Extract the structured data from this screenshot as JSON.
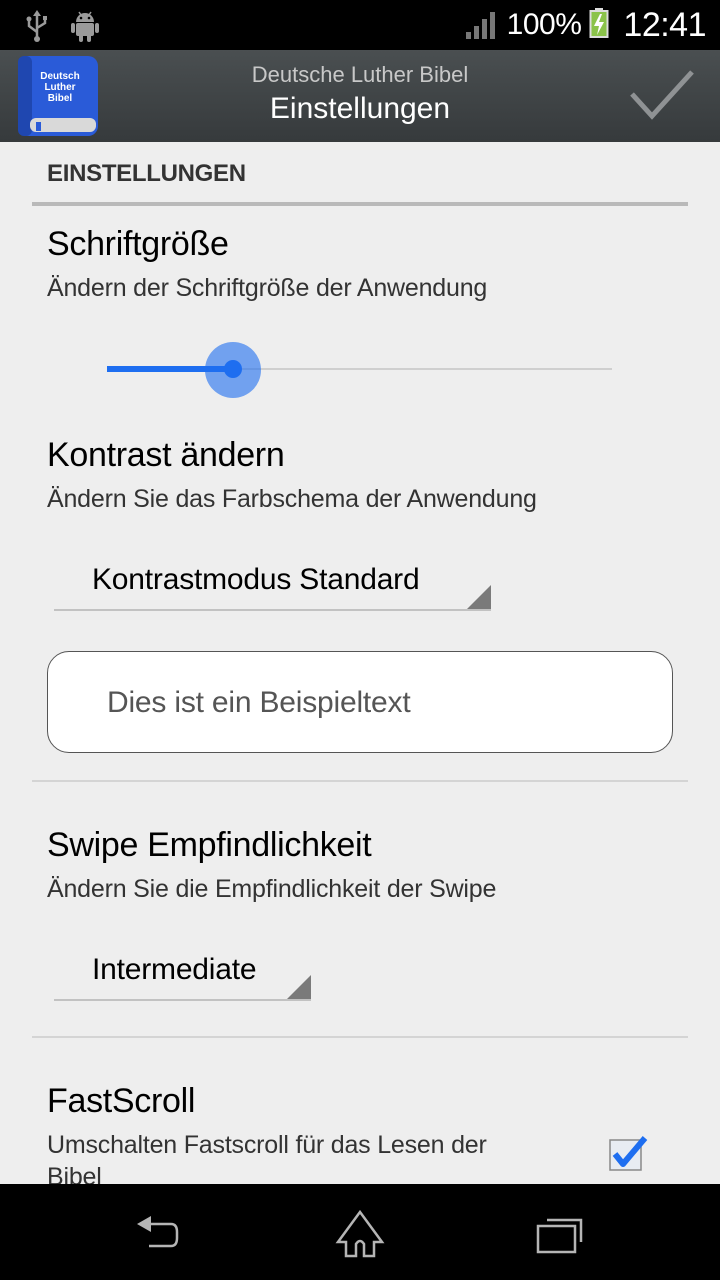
{
  "status_bar": {
    "left_icons": [
      "usb-icon",
      "android-debug-icon"
    ],
    "signal_icon": "signal-strength-icon",
    "battery_percent": "100%",
    "battery_icon": "battery-charging-icon",
    "time": "12:41"
  },
  "action_bar": {
    "app_icon_lines": [
      "Deutsch",
      "Luther",
      "Bibel"
    ],
    "subtitle": "Deutsche Luther Bibel",
    "title": "Einstellungen",
    "done_icon": "checkmark-icon"
  },
  "settings": {
    "category": "EINSTELLUNGEN",
    "font_size": {
      "title": "Schriftgröße",
      "summary": "Ändern der Schriftgröße der Anwendung",
      "slider_value_fraction": 0.25
    },
    "contrast": {
      "title": "Kontrast ändern",
      "summary": "Ändern Sie das Farbschema der Anwendung",
      "selected": "Kontrastmodus Standard",
      "sample_text": "Dies ist ein Beispieltext"
    },
    "swipe": {
      "title": "Swipe Empfindlichkeit",
      "summary": "Ändern Sie die Empfindlichkeit der Swipe",
      "selected": "Intermediate"
    },
    "fastscroll": {
      "title": "FastScroll",
      "summary_line1": "Umschalten Fastscroll für das Lesen der",
      "summary_line2": "Bibel",
      "checked": true
    }
  },
  "colors": {
    "accent": "#1e6ef0",
    "background": "#eeeeee",
    "action_bar": "#3f4446"
  },
  "nav_bar": {
    "buttons": [
      "back-icon",
      "home-icon",
      "recent-apps-icon"
    ]
  }
}
